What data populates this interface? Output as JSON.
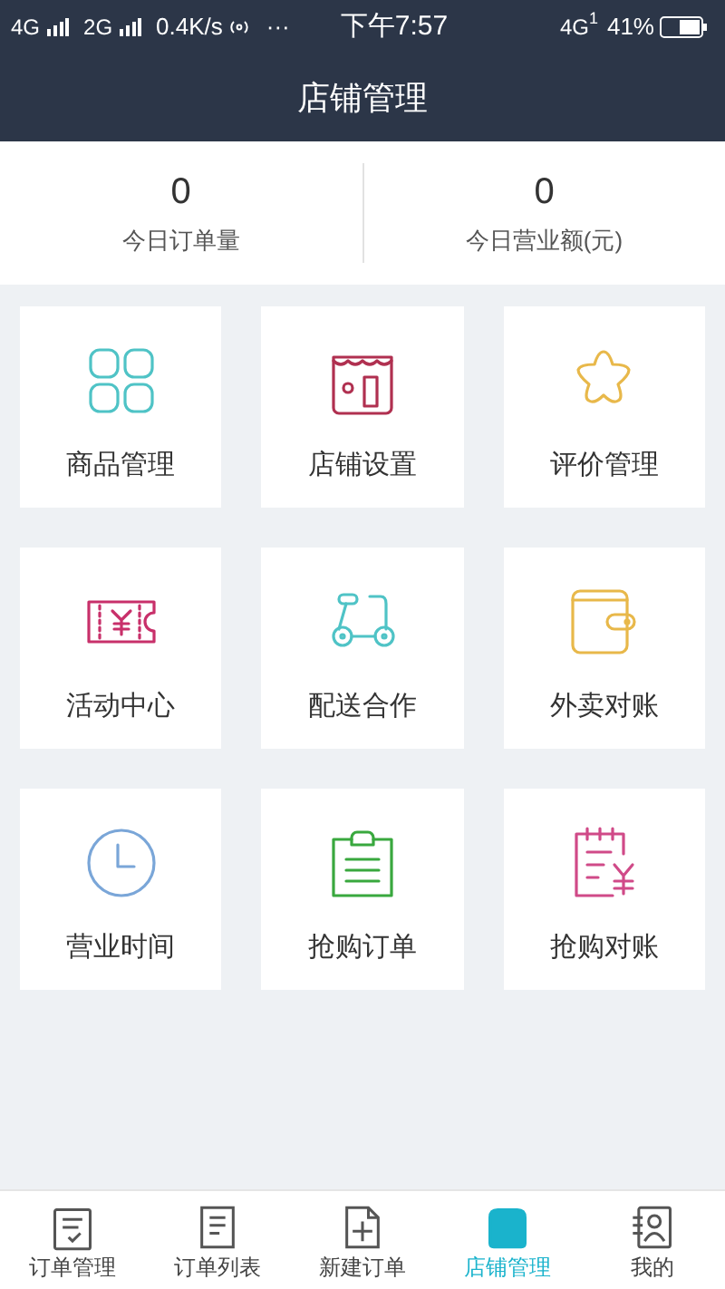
{
  "status_bar": {
    "left": [
      "4G",
      "2G"
    ],
    "speed": "0.4K/s",
    "more": "···",
    "time": "下午7:57",
    "net": "4G",
    "sim": "1",
    "battery": "41%"
  },
  "header": {
    "title": "店铺管理"
  },
  "stats": [
    {
      "value": "0",
      "label": "今日订单量"
    },
    {
      "value": "0",
      "label": "今日营业额(元)"
    }
  ],
  "tiles": [
    {
      "label": "商品管理"
    },
    {
      "label": "店铺设置"
    },
    {
      "label": "评价管理"
    },
    {
      "label": "活动中心"
    },
    {
      "label": "配送合作"
    },
    {
      "label": "外卖对账"
    },
    {
      "label": "营业时间"
    },
    {
      "label": "抢购订单"
    },
    {
      "label": "抢购对账"
    }
  ],
  "tab_bar": [
    {
      "label": "订单管理",
      "selected": false
    },
    {
      "label": "订单列表",
      "selected": false
    },
    {
      "label": "新建订单",
      "selected": false
    },
    {
      "label": "店铺管理",
      "selected": true
    },
    {
      "label": "我的",
      "selected": false
    }
  ]
}
